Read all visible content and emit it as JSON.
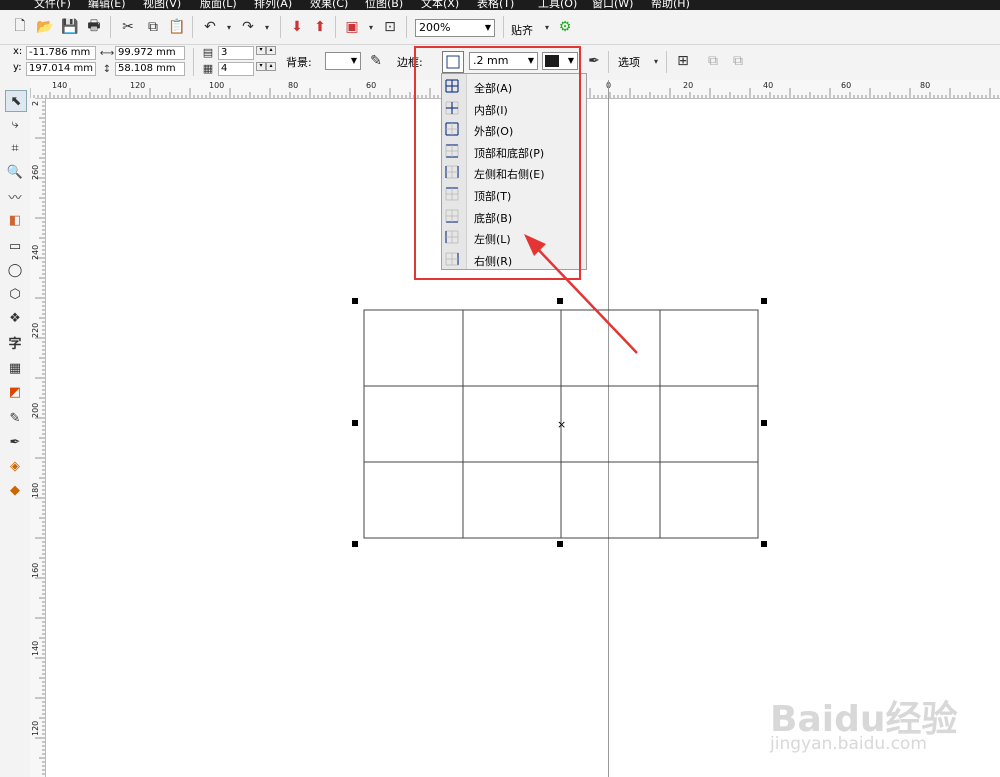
{
  "menu": [
    "文件(F)",
    "编辑(E)",
    "视图(V)",
    "版面(L)",
    "排列(A)",
    "效果(C)",
    "位图(B)",
    "文本(X)",
    "表格(T)",
    "工具(O)",
    "窗口(W)",
    "帮助(H)"
  ],
  "toolbar": {
    "zoom_value": "200%",
    "snap_label": "贴齐"
  },
  "property_bar": {
    "x_label": "x:",
    "x_value": "-11.786 mm",
    "y_label": "y:",
    "y_value": "197.014 mm",
    "width_value": "99.972 mm",
    "height_value": "58.108 mm",
    "rows_value": "3",
    "cols_value": "4",
    "background_label": "背景:",
    "border_label": "边框:",
    "border_width": ".2 mm",
    "border_color": "#1a1a1a",
    "options_label": "选项"
  },
  "rulers": {
    "h_labels": [
      "140",
      "120",
      "100",
      "80",
      "60",
      "0",
      "20",
      "40",
      "60",
      "80"
    ],
    "v_labels": [
      "260",
      "240",
      "220",
      "200",
      "180",
      "160",
      "140",
      "120"
    ],
    "h_marker": "2"
  },
  "border_menu": {
    "items": [
      {
        "label": "全部(A)",
        "icon": "border-all-icon"
      },
      {
        "label": "内部(I)",
        "icon": "border-inside-icon"
      },
      {
        "label": "外部(O)",
        "icon": "border-outside-icon"
      },
      {
        "label": "顶部和底部(P)",
        "icon": "border-top-bottom-icon"
      },
      {
        "label": "左侧和右侧(E)",
        "icon": "border-left-right-icon"
      },
      {
        "label": "顶部(T)",
        "icon": "border-top-icon"
      },
      {
        "label": "底部(B)",
        "icon": "border-bottom-icon"
      },
      {
        "label": "左侧(L)",
        "icon": "border-left-icon"
      },
      {
        "label": "右侧(R)",
        "icon": "border-right-icon"
      }
    ]
  },
  "table": {
    "rows": 3,
    "cols": 4
  },
  "annotation_color": "#e53434",
  "watermark": {
    "logo": "Baidu经验",
    "url": "jingyan.baidu.com"
  }
}
